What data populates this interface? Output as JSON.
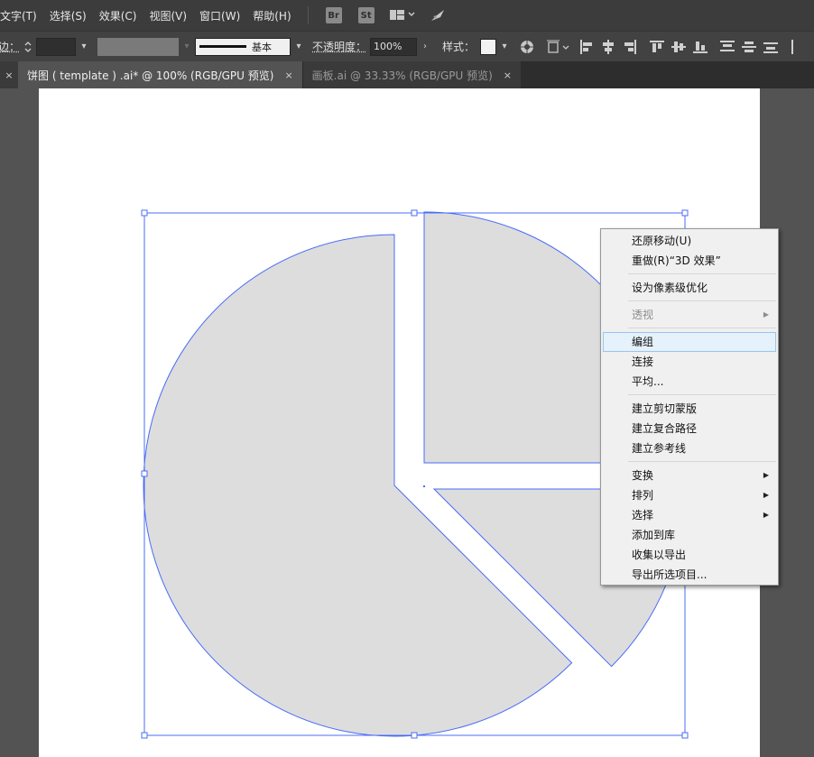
{
  "menubar": {
    "items": [
      "文字(T)",
      "选择(S)",
      "效果(C)",
      "视图(V)",
      "窗口(W)",
      "帮助(H)"
    ],
    "bridge_label": "Br",
    "stock_label": "St",
    "workspace_icon": "workspace-switcher-icon",
    "sync_icon": "rocket-icon"
  },
  "controlbar": {
    "edge_label": "边：",
    "stroke_style_label": "基本",
    "opacity_label": "不透明度：",
    "opacity_value": "100%",
    "style_label": "样式："
  },
  "tabs": [
    {
      "label": "饼图 ( template ) .ai* @ 100% (RGB/GPU 预览)",
      "close": "×",
      "active": true
    },
    {
      "label": "画板.ai @ 33.33% (RGB/GPU 预览)",
      "close": "×",
      "active": false
    }
  ],
  "tab_left_close": "×",
  "chart_data": {
    "type": "pie",
    "slices": [
      {
        "label": "",
        "value": 62.5
      },
      {
        "label": "",
        "value": 25
      },
      {
        "label": "",
        "value": 12.5
      }
    ],
    "exploded": true,
    "fill_color": "#dddddd",
    "stroke_color": "#4a6cf7"
  },
  "context_menu": {
    "groups": [
      [
        {
          "label": "还原移动(U)",
          "submenu": false,
          "disabled": false,
          "highlighted": false
        },
        {
          "label": "重做(R)“3D 效果”",
          "submenu": false,
          "disabled": false,
          "highlighted": false
        }
      ],
      [
        {
          "label": "设为像素级优化",
          "submenu": false,
          "disabled": false,
          "highlighted": false
        }
      ],
      [
        {
          "label": "透视",
          "submenu": true,
          "disabled": true,
          "highlighted": false
        }
      ],
      [
        {
          "label": "编组",
          "submenu": false,
          "disabled": false,
          "highlighted": true
        },
        {
          "label": "连接",
          "submenu": false,
          "disabled": false,
          "highlighted": false
        },
        {
          "label": "平均...",
          "submenu": false,
          "disabled": false,
          "highlighted": false
        }
      ],
      [
        {
          "label": "建立剪切蒙版",
          "submenu": false,
          "disabled": false,
          "highlighted": false
        },
        {
          "label": "建立复合路径",
          "submenu": false,
          "disabled": false,
          "highlighted": false
        },
        {
          "label": "建立参考线",
          "submenu": false,
          "disabled": false,
          "highlighted": false
        }
      ],
      [
        {
          "label": "变换",
          "submenu": true,
          "disabled": false,
          "highlighted": false
        },
        {
          "label": "排列",
          "submenu": true,
          "disabled": false,
          "highlighted": false
        },
        {
          "label": "选择",
          "submenu": true,
          "disabled": false,
          "highlighted": false
        },
        {
          "label": "添加到库",
          "submenu": false,
          "disabled": false,
          "highlighted": false
        },
        {
          "label": "收集以导出",
          "submenu": false,
          "disabled": false,
          "highlighted": false
        },
        {
          "label": "导出所选项目...",
          "submenu": false,
          "disabled": false,
          "highlighted": false
        }
      ]
    ],
    "submenu_arrow": "▶"
  }
}
